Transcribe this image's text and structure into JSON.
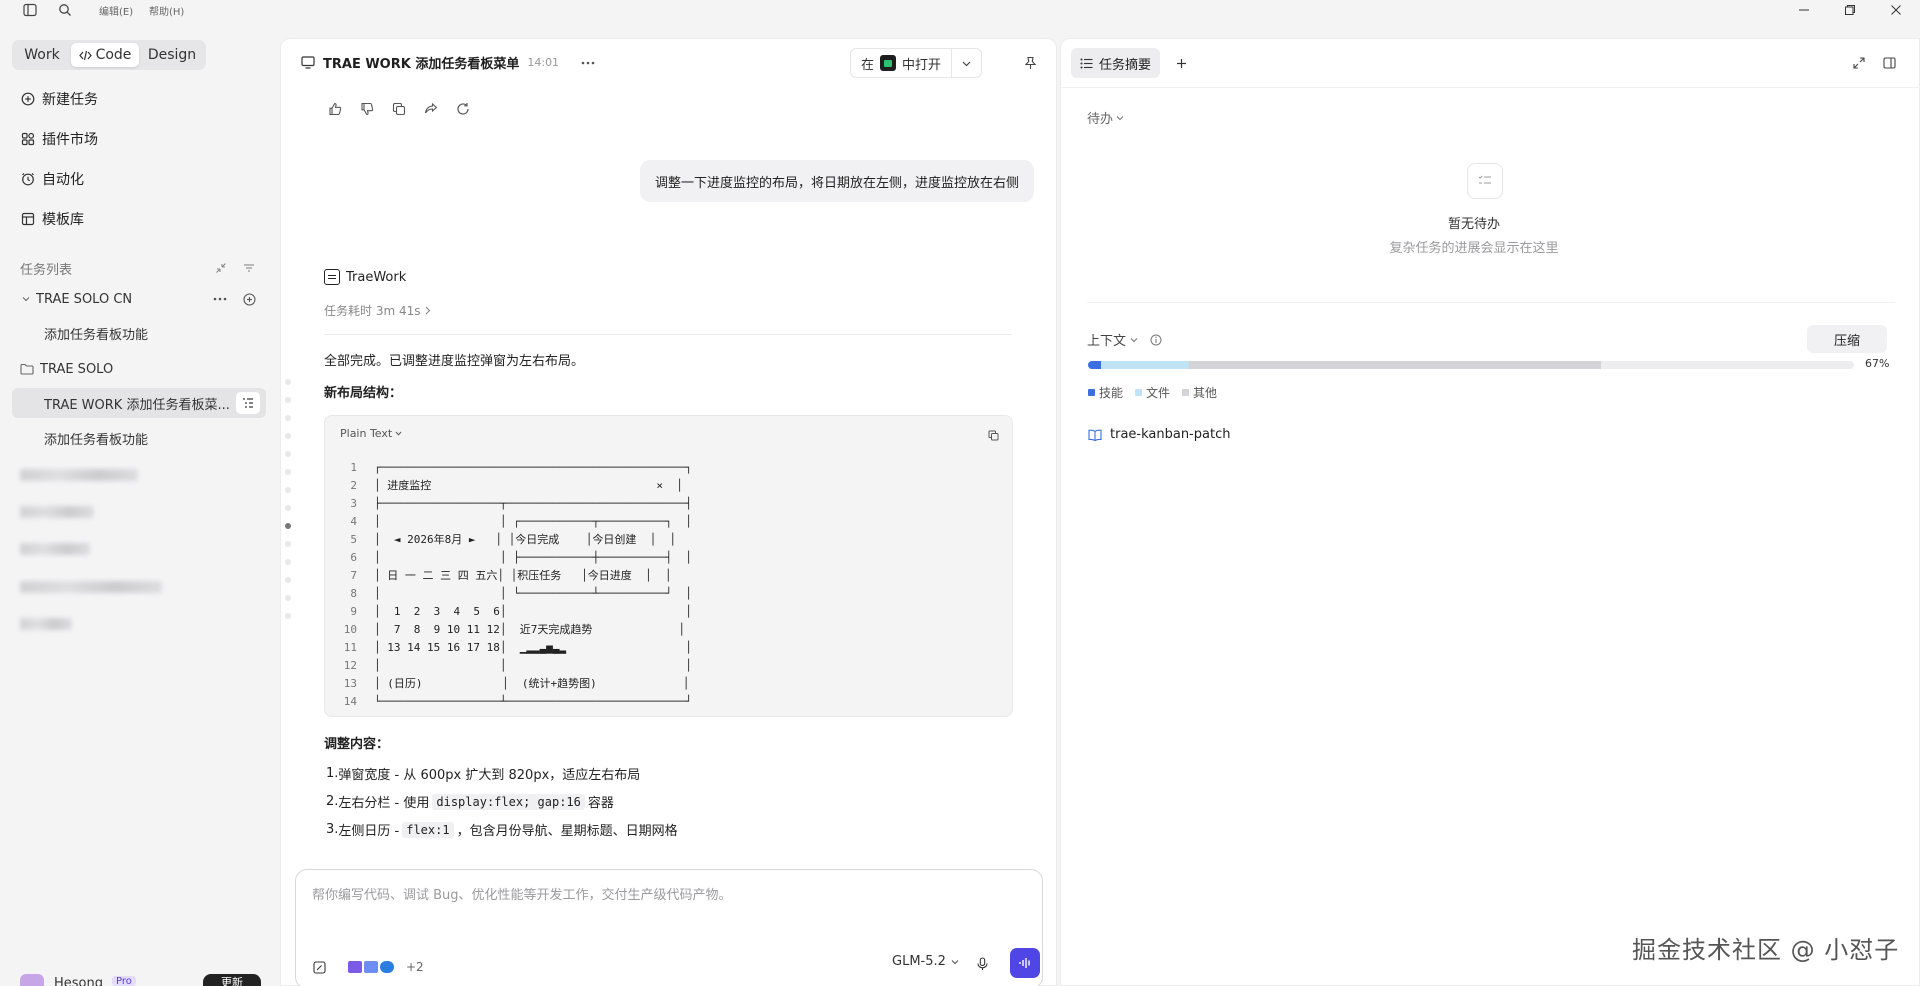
{
  "topbar": {
    "menu_edit": "编辑(E)",
    "menu_help": "帮助(H)"
  },
  "sidebar": {
    "modes": [
      {
        "label": "Work"
      },
      {
        "label": "Code",
        "active": true
      },
      {
        "label": "Design"
      }
    ],
    "nav": [
      {
        "label": "新建任务",
        "icon": "new-task-icon"
      },
      {
        "label": "插件市场",
        "icon": "plugins-icon"
      },
      {
        "label": "自动化",
        "icon": "clock-icon"
      },
      {
        "label": "模板库",
        "icon": "template-icon"
      }
    ],
    "tasklist_title": "任务列表",
    "group1": {
      "name": "TRAE SOLO CN",
      "items": [
        "添加任务看板功能"
      ]
    },
    "group2": {
      "name": "TRAE SOLO",
      "items": [
        "TRAE WORK 添加任务看板菜...",
        "添加任务看板功能"
      ]
    },
    "user": {
      "name": "Hesong",
      "badge": "Pro",
      "update": "更新"
    }
  },
  "chat": {
    "title": "TRAE WORK 添加任务看板菜单",
    "time": "14:01",
    "open_in_prefix": "在",
    "open_in_label": "中打开",
    "user_message": "调整一下进度监控的布局，将日期放在左侧，进度监控放在右侧",
    "agent_name": "TraeWork",
    "duration": "任务耗时 3m 41s",
    "summary": "全部完成。已调整进度监控弹窗为左右布局。",
    "layout_heading": "新布局结构：",
    "code_lang": "Plain Text",
    "code_line_numbers": "1\n2\n3\n4\n5\n6\n7\n8\n9\n10\n11\n12\n13\n14",
    "code_text": "┌──────────────────────────────────────────────┐\n│ 进度监控                                  ×  │\n├──────────────────┬───────────────────────────┤\n│                  │ ┌───────────┬──────────┐  │\n│  ◄ 2026年8月 ►   │ │今日完成    │今日创建  │  │\n│                  │ ├───────────┼──────────┤  │\n│ 日 一 二 三 四 五六│ │积压任务   │今日进度  │  │\n│                  │ └───────────┴──────────┘  │\n│  1  2  3  4  5  6│                           │\n│  7  8  9 10 11 12│  近7天完成趋势             │\n│ 13 14 15 16 17 18│  ▁▂▂▃▅▃▂                  │\n│                  │                           │\n│ (日历)            │  (统计+趋势图)             │\n└──────────────────┴───────────────────────────┘",
    "changes_heading": "调整内容：",
    "changes": [
      {
        "n": "1.",
        "pre": "弹窗宽度 - 从 600px 扩大到 820px，适应左右布局",
        "code": "",
        "post": ""
      },
      {
        "n": "2.",
        "pre": "左右分栏 - 使用",
        "code": "display:flex; gap:16",
        "post": "容器"
      },
      {
        "n": "3.",
        "pre": "左侧日历 -",
        "code": "flex:1",
        "post": "，包含月份导航、星期标题、日期网格"
      }
    ],
    "composer_placeholder": "帮你编写代码、调试 Bug、优化性能等开发工作，交付生产级代码产物。",
    "attach_count": "+2",
    "model": "GLM-5.2"
  },
  "panel": {
    "tab_label": "任务摘要",
    "todo_title": "待办",
    "empty_title": "暂无待办",
    "empty_sub": "复杂任务的进展会显示在这里",
    "context_title": "上下文",
    "compress_label": "压缩",
    "usage_percent": "67%",
    "usage": {
      "skills": 0.017,
      "files": 0.115,
      "other": 0.538
    },
    "legend": [
      {
        "label": "技能",
        "color": "#3b6fe0"
      },
      {
        "label": "文件",
        "color": "#bfe3f5"
      },
      {
        "label": "其他",
        "color": "#d4d4d8"
      }
    ],
    "skill_item": "trae-kanban-patch"
  },
  "watermark": "掘金技术社区 @ 小怼子"
}
